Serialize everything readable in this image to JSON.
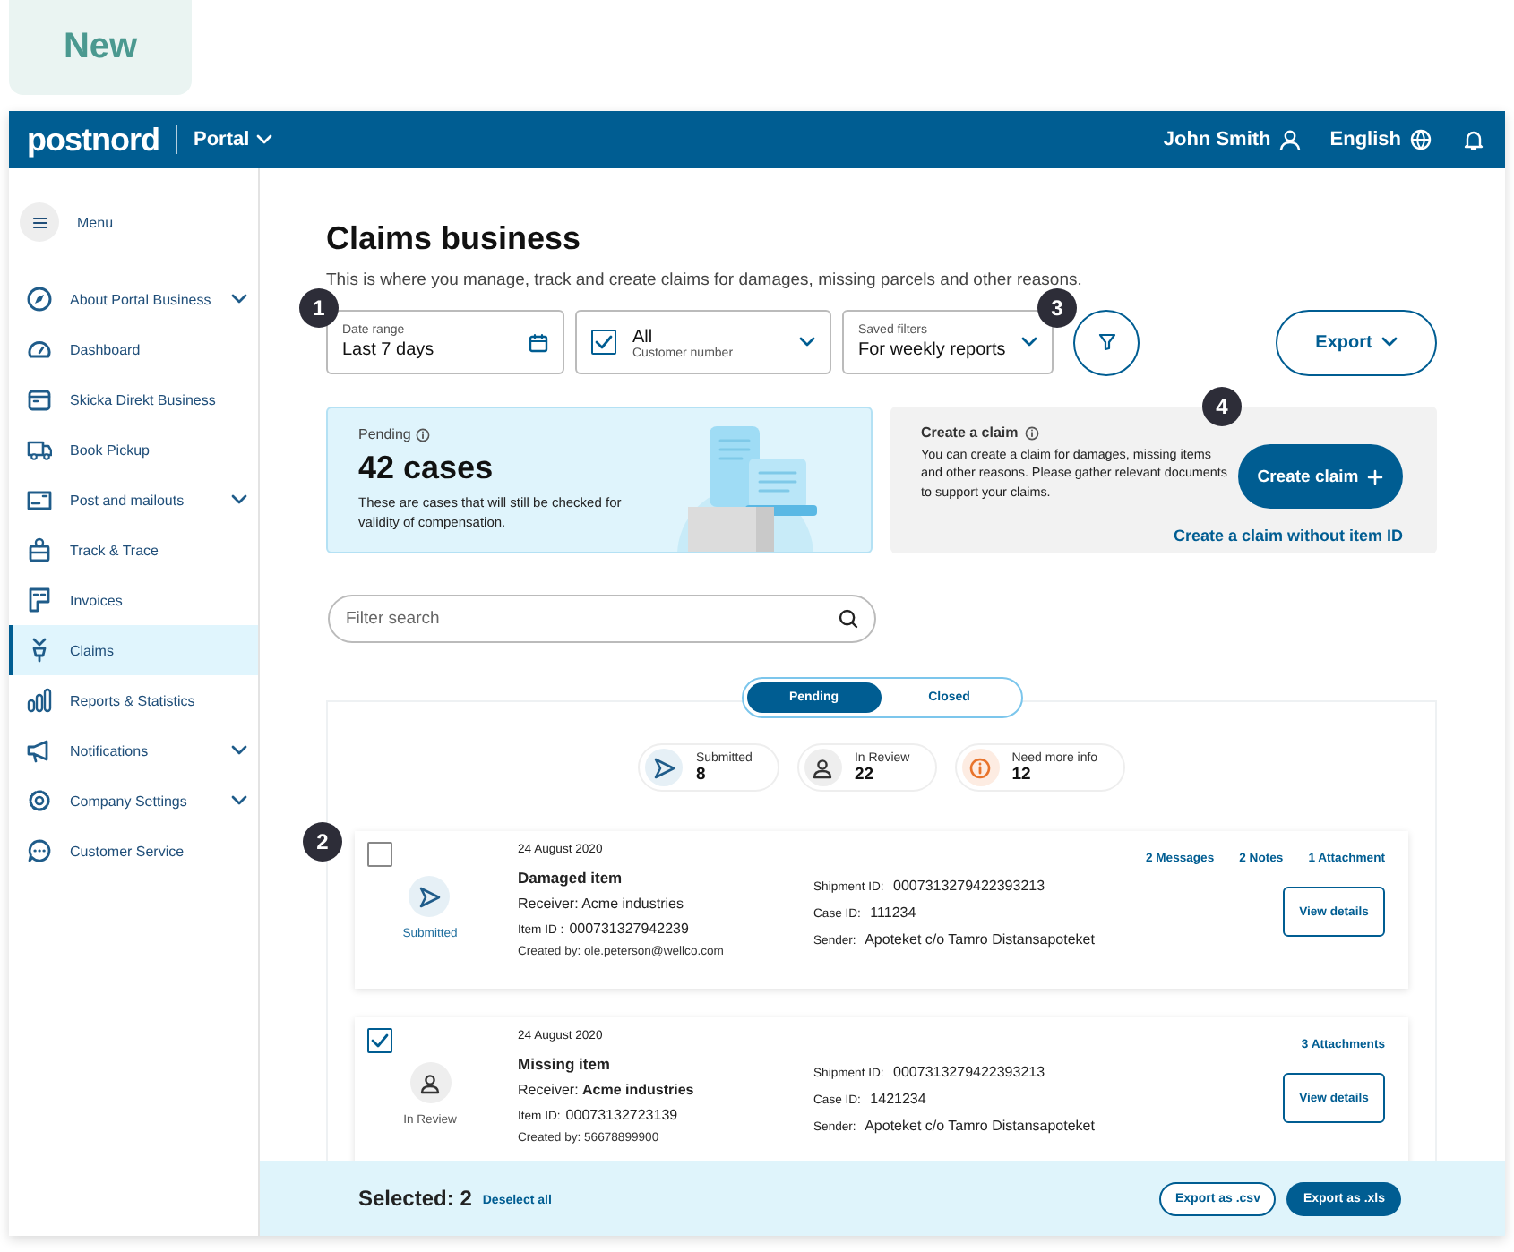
{
  "badge": "New",
  "header": {
    "logo": "postnord",
    "portal": "Portal",
    "user": "John Smith",
    "language": "English"
  },
  "sidebar": {
    "menu": "Menu",
    "items": [
      {
        "label": "About Portal Business",
        "has_submenu": true,
        "selected": false
      },
      {
        "label": "Dashboard",
        "has_submenu": false,
        "selected": false
      },
      {
        "label": "Skicka Direkt Business",
        "has_submenu": false,
        "selected": false
      },
      {
        "label": "Book Pickup",
        "has_submenu": false,
        "selected": false
      },
      {
        "label": "Post and mailouts",
        "has_submenu": true,
        "selected": false
      },
      {
        "label": "Track & Trace",
        "has_submenu": false,
        "selected": false
      },
      {
        "label": "Invoices",
        "has_submenu": false,
        "selected": false
      },
      {
        "label": "Claims",
        "has_submenu": false,
        "selected": true
      },
      {
        "label": "Reports & Statistics",
        "has_submenu": false,
        "selected": false
      },
      {
        "label": "Notifications",
        "has_submenu": true,
        "selected": false
      },
      {
        "label": "Company Settings",
        "has_submenu": true,
        "selected": false
      },
      {
        "label": "Customer Service",
        "has_submenu": false,
        "selected": false
      }
    ]
  },
  "page": {
    "title": "Claims business",
    "subtitle": "This is where you manage, track and create claims for damages, missing parcels and other reasons."
  },
  "filters": {
    "date_range": {
      "label": "Date range",
      "value": "Last 7 days",
      "marker": "1"
    },
    "customer": {
      "value": "All",
      "label": "Customer number",
      "checked": true
    },
    "saved_filters": {
      "label": "Saved filters",
      "value": "For weekly reports"
    },
    "filter_button": {
      "marker": "3"
    },
    "export": "Export"
  },
  "pending": {
    "label": "Pending",
    "count": "42 cases",
    "text": "These are cases that will still be checked for validity of compensation."
  },
  "create": {
    "title": "Create a claim",
    "text": "You can create a claim for damages, missing items and other reasons. Please gather relevant documents to support your claims.",
    "button": "Create claim",
    "marker": "4",
    "link": "Create a claim without item ID"
  },
  "search": {
    "placeholder": "Filter search"
  },
  "tabs": [
    {
      "label": "Pending",
      "selected": true
    },
    {
      "label": "Closed",
      "selected": false
    }
  ],
  "stats": [
    {
      "kind": "submitted",
      "label": "Submitted",
      "count": "8"
    },
    {
      "kind": "review",
      "label": "In Review",
      "count": "22"
    },
    {
      "kind": "info",
      "label": "Need more info",
      "count": "12"
    }
  ],
  "cases": [
    {
      "checked": false,
      "marker": "2",
      "status": {
        "kind": "submitted",
        "label": "Submitted"
      },
      "date": "24 August 2020",
      "title": "Damaged item",
      "receiver": "Receiver: Acme industries",
      "item_id": {
        "label": "Item ID :",
        "value": "000731327942239"
      },
      "created_by": "Created by: ole.peterson@wellco.com",
      "shipment": {
        "label": "Shipment ID:",
        "value": "0007313279422393213"
      },
      "case_id": {
        "label": "Case ID:",
        "value": "111234"
      },
      "sender": {
        "label": "Sender:",
        "value": "Apoteket c/o Tamro Distansapoteket"
      },
      "links": [
        "2 Messages",
        "2 Notes",
        "1 Attachment"
      ],
      "button": "View details"
    },
    {
      "checked": true,
      "status": {
        "kind": "review",
        "label": "In Review"
      },
      "date": "24 August 2020",
      "title": "Missing item",
      "receiver": "Receiver: **Acme industries**",
      "item_id": {
        "label": "Item ID:",
        "value": "00073132723139"
      },
      "created_by": "Created by: 56678899900",
      "shipment": {
        "label": "Shipment ID:",
        "value": "0007313279422393213"
      },
      "case_id": {
        "label": "Case ID:",
        "value": "1421234"
      },
      "sender": {
        "label": "Sender:",
        "value": "Apoteket c/o Tamro Distansapoteket"
      },
      "links": [
        "3 Attachments"
      ],
      "button": "View details"
    }
  ],
  "selection_bar": {
    "selected": "Selected: 2",
    "deselect": "Deselect all",
    "export_csv": "Export as .csv",
    "export_xls": "Export as .xls"
  }
}
